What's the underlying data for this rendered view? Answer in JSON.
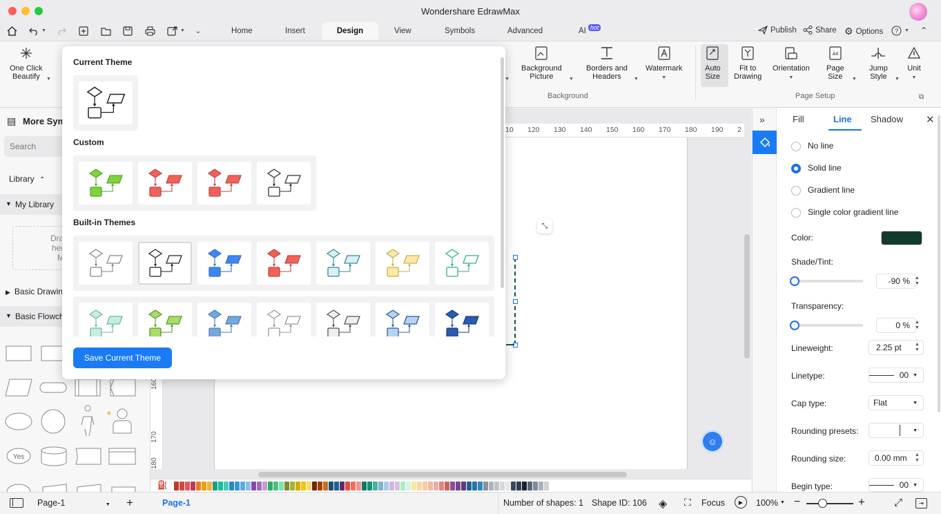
{
  "app": {
    "title": "Wondershare EdrawMax"
  },
  "menu_tabs": [
    {
      "label": "Home"
    },
    {
      "label": "Insert"
    },
    {
      "label": "Design"
    },
    {
      "label": "View"
    },
    {
      "label": "Symbols"
    },
    {
      "label": "Advanced"
    },
    {
      "label": "AI",
      "badge": "hot"
    }
  ],
  "top_right": {
    "publish": "Publish",
    "share": "Share",
    "options": "Options"
  },
  "ribbon": {
    "one_click_beautify": "One Click\nBeautify",
    "background_picture": "Background\nPicture",
    "borders_headers": "Borders and\nHeaders",
    "watermark": "Watermark",
    "auto_size": "Auto\nSize",
    "fit_to_drawing": "Fit to\nDrawing",
    "orientation": "Orientation",
    "page_size": "Page\nSize",
    "jump_style": "Jump\nStyle",
    "unit": "Unit",
    "group_background": "Background",
    "group_page_setup": "Page Setup"
  },
  "sidebar": {
    "title": "More Sym",
    "search_placeholder": "Search",
    "library": "Library",
    "my_library": "My Library",
    "drag_hint": "Drag\nhere\nMy",
    "basic_drawing": "Basic Drawin",
    "basic_flowchart": "Basic Flowch",
    "yes_shape": "Yes"
  },
  "theme_popup": {
    "current_theme": "Current Theme",
    "custom": "Custom",
    "builtin": "Built-in Themes",
    "save_button": "Save Current Theme",
    "custom_themes": [
      {
        "fill": "#7ed23c",
        "stroke": "#5aa82a"
      },
      {
        "fill": "#f0625a",
        "stroke": "#c94540"
      },
      {
        "fill": "#f0625a",
        "stroke": "#c94540"
      },
      {
        "fill": "#ffffff",
        "stroke": "#333333"
      }
    ],
    "builtin_row1": [
      {
        "fill": "#ffffff",
        "stroke": "#888888"
      },
      {
        "fill": "#ffffff",
        "stroke": "#222222"
      },
      {
        "fill": "#3f86f2",
        "stroke": "#2d6fd8"
      },
      {
        "fill": "#f0625a",
        "stroke": "#c94540"
      },
      {
        "fill": "#d8f1f6",
        "stroke": "#3a8796"
      },
      {
        "fill": "#fbeaa5",
        "stroke": "#c9b04a"
      },
      {
        "fill": "#ffffff",
        "stroke": "#2fae8a"
      }
    ],
    "builtin_row2": [
      {
        "fill": "#c7ece3",
        "stroke": "#6fb9a8"
      },
      {
        "fill": "#a7dc6a",
        "stroke": "#5a9a2a"
      },
      {
        "fill": "#74a8dc",
        "stroke": "#4a7fb8"
      },
      {
        "fill": "#ffffff",
        "stroke": "#999999"
      },
      {
        "fill": "#eeeeee",
        "stroke": "#555555"
      },
      {
        "fill": "#b7d2f0",
        "stroke": "#2e5d9a"
      },
      {
        "fill": "#2a5bb0",
        "stroke": "#1d3f7d"
      }
    ]
  },
  "ruler": {
    "ticks": [
      "10",
      "120",
      "130",
      "140",
      "150",
      "160",
      "170",
      "180",
      "190",
      "2"
    ],
    "left_ticks": [
      "160",
      "170",
      "180"
    ]
  },
  "right_panel": {
    "tabs": [
      "Fill",
      "Line",
      "Shadow"
    ],
    "line_options": [
      "No line",
      "Solid line",
      "Gradient line",
      "Single color gradient line"
    ],
    "selected_option": "Solid line",
    "color_label": "Color:",
    "color_value": "#143a2c",
    "shade_label": "Shade/Tint:",
    "shade_value": "-90 %",
    "shade_level": 0.05,
    "transparency_label": "Transparency:",
    "transparency_value": "0 %",
    "lineweight_label": "Lineweight:",
    "lineweight_value": "2.25 pt",
    "linetype_label": "Linetype:",
    "linetype_value": "00",
    "cap_label": "Cap type:",
    "cap_value": "Flat",
    "rounding_presets_label": "Rounding presets:",
    "rounding_size_label": "Rounding size:",
    "rounding_size_value": "0.00 mm",
    "begin_type_label": "Begin type:",
    "begin_type_value": "00"
  },
  "statusbar": {
    "page_select": "Page-1",
    "page_tab": "Page-1",
    "num_shapes": "Number of shapes: 1",
    "shape_id": "Shape ID: 106",
    "focus": "Focus",
    "zoom": "100%"
  },
  "palette_colors": [
    "#c0392b",
    "#d64545",
    "#e05858",
    "#b83b5e",
    "#e67e22",
    "#f39c12",
    "#f5b041",
    "#16a085",
    "#1abc9c",
    "#48c9b0",
    "#2e86c1",
    "#3498db",
    "#5dade2",
    "#85c1e9",
    "#8e44ad",
    "#a569bd",
    "#c39bd3",
    "#27ae60",
    "#52be80",
    "#82e0aa",
    "#7d8c2a",
    "#a3b33a",
    "#d4ac0d",
    "#f1c40f",
    "#f7dc6f",
    "#6e2c00",
    "#a04000",
    "#ca6f1e",
    "#1b4f72",
    "#21618c",
    "#5b2c6f",
    "#e74c3c",
    "#ec7063",
    "#f1948a",
    "#117864",
    "#148f77",
    "#45b39d",
    "#7fb3d5",
    "#a9cce3",
    "#d2b4de",
    "#d7bde2",
    "#abebc6",
    "#d5f5e3",
    "#f9e79f",
    "#fad7a0",
    "#f5cba7",
    "#edbb99",
    "#e6b0aa",
    "#d98880",
    "#cd6155",
    "#884ea0",
    "#76448a",
    "#633974",
    "#1f618d",
    "#2874a6",
    "#2e86c1",
    "#85929e",
    "#aab7b8",
    "#bdc3c7",
    "#d5d8dc",
    "#e5e7e9",
    "#34495e",
    "#2c3e50",
    "#17202a",
    "#566573",
    "#808b96",
    "#abb2b9",
    "#ccd1d1"
  ]
}
